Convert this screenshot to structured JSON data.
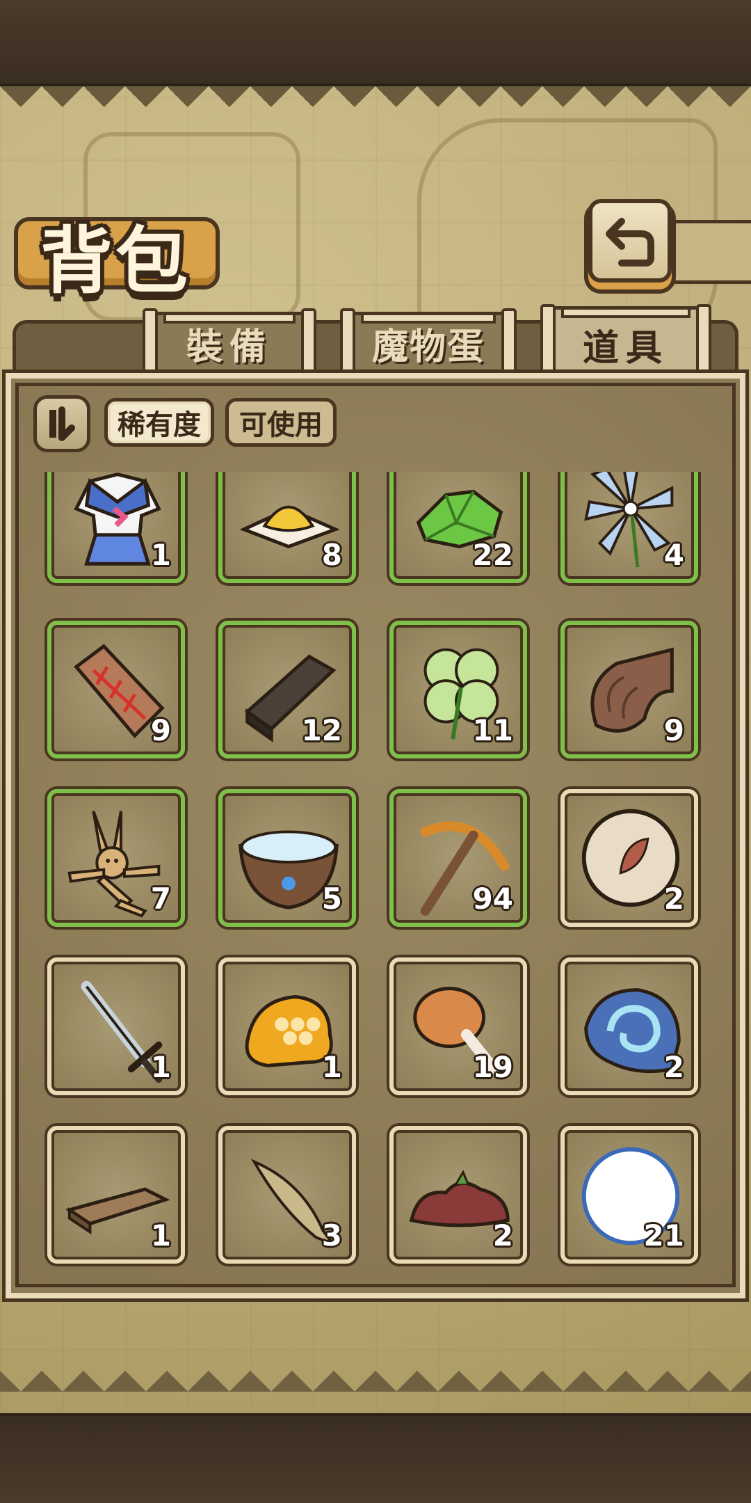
{
  "title": "背包",
  "tabs": [
    {
      "label": "裝備",
      "active": false
    },
    {
      "label": "魔物蛋",
      "active": false
    },
    {
      "label": "道具",
      "active": true
    }
  ],
  "filters": {
    "rarity_label": "稀有度",
    "usable_label": "可使用"
  },
  "items": [
    {
      "icon": "school-uniform-icon",
      "qty": "1",
      "rarity": "green"
    },
    {
      "icon": "powder-dish-icon",
      "qty": "8",
      "rarity": "green"
    },
    {
      "icon": "green-crystal-icon",
      "qty": "22",
      "rarity": "green"
    },
    {
      "icon": "blue-flower-icon",
      "qty": "4",
      "rarity": "green"
    },
    {
      "icon": "fish-bone-tablet-icon",
      "qty": "9",
      "rarity": "green"
    },
    {
      "icon": "dark-wood-icon",
      "qty": "12",
      "rarity": "green"
    },
    {
      "icon": "four-leaf-clover-icon",
      "qty": "11",
      "rarity": "green"
    },
    {
      "icon": "horn-shell-icon",
      "qty": "9",
      "rarity": "green"
    },
    {
      "icon": "straw-doll-icon",
      "qty": "7",
      "rarity": "green"
    },
    {
      "icon": "water-bowl-icon",
      "qty": "5",
      "rarity": "green"
    },
    {
      "icon": "pickaxe-icon",
      "qty": "94",
      "rarity": "green"
    },
    {
      "icon": "leaf-orb-icon",
      "qty": "2",
      "rarity": "normal"
    },
    {
      "icon": "sword-icon",
      "qty": "1",
      "rarity": "normal"
    },
    {
      "icon": "honeycomb-icon",
      "qty": "1",
      "rarity": "normal"
    },
    {
      "icon": "drumstick-icon",
      "qty": "19",
      "rarity": "normal"
    },
    {
      "icon": "blue-shell-icon",
      "qty": "2",
      "rarity": "normal"
    },
    {
      "icon": "wood-plank-icon",
      "qty": "1",
      "rarity": "normal"
    },
    {
      "icon": "small-fish-icon",
      "qty": "3",
      "rarity": "normal"
    },
    {
      "icon": "soil-pile-icon",
      "qty": "2",
      "rarity": "normal"
    },
    {
      "icon": "cotton-ball-icon",
      "qty": "21",
      "rarity": "normal"
    }
  ]
}
